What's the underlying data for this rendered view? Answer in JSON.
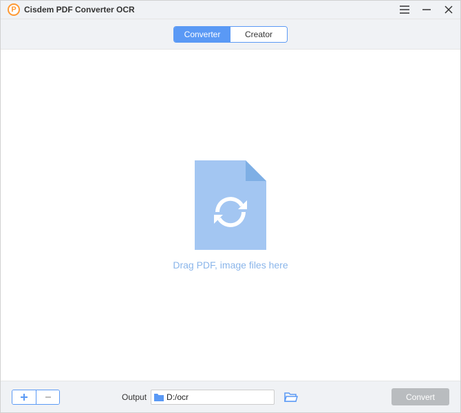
{
  "app": {
    "title": "Cisdem PDF Converter OCR"
  },
  "tabs": {
    "converter": "Converter",
    "creator": "Creator"
  },
  "dropzone": {
    "hint": "Drag PDF, image files here"
  },
  "output": {
    "label": "Output",
    "path": "D:/ocr"
  },
  "actions": {
    "convert": "Convert"
  },
  "icons": {
    "logo": "app-logo",
    "menu": "hamburger-icon",
    "minimize": "minimize-icon",
    "close": "close-icon",
    "file": "file-refresh-icon",
    "add": "plus-icon",
    "remove": "minus-icon",
    "folder_small": "folder-icon",
    "browse": "folder-open-icon"
  },
  "colors": {
    "accent": "#5a99f5",
    "drop_icon": "#a3c6f2",
    "drop_text": "#8ab5ea",
    "convert_bg": "#b9bcbf",
    "brand_orange": "#ff9933"
  }
}
